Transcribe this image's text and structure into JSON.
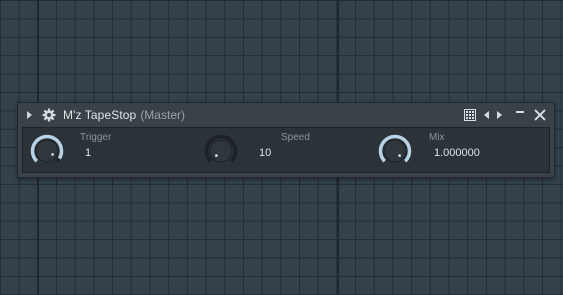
{
  "plugin": {
    "title": "M'z TapeStop",
    "subtitle": "(Master)",
    "params": [
      {
        "label": "Trigger",
        "value": "1",
        "level": 0.95
      },
      {
        "label": "Speed",
        "value": "10",
        "level": 0.0
      },
      {
        "label": "Mix",
        "value": "1.000000",
        "level": 1.0
      }
    ]
  },
  "colors": {
    "background": "#34414b",
    "window": "#3a4147",
    "panel": "#2c3338",
    "knob_arc": "#b9d3e6"
  },
  "icons": [
    "collapse-arrow-icon",
    "gear-icon",
    "grid-icon",
    "prev-arrow-icon",
    "next-arrow-icon",
    "minimize-icon",
    "close-icon"
  ]
}
